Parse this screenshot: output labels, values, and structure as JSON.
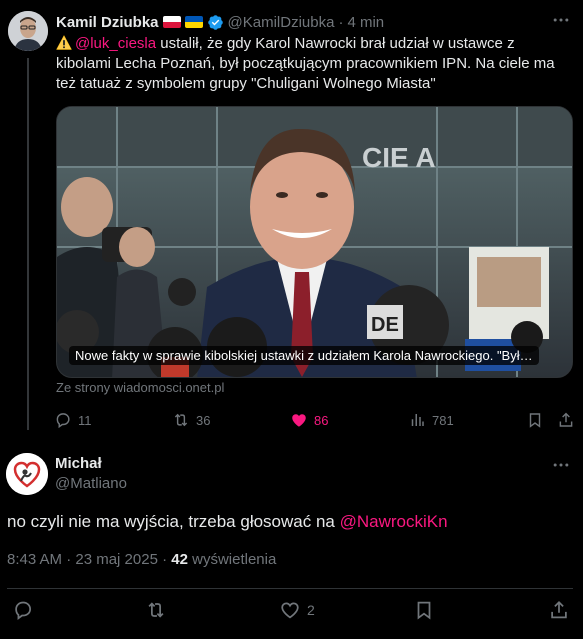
{
  "tweet": {
    "author_name": "Kamil Dziubka",
    "author_handle": "@KamilDziubka",
    "separator": "·",
    "time_ago": "4 min",
    "mention": "@luk_ciesla",
    "text_part1": " ustalił, że gdy Karol Nawrocki brał udział w ustawce z kibolami Lecha Poznań, był początkującym pracownikiem IPN. Na ciele ma też tatuaż z symbolem grupy \"Chuligani Wolnego Miasta\"",
    "card": {
      "caption": "Nowe fakty w sprawie kibolskiej ustawki z udziałem Karola Nawrockiego. \"Był ...",
      "source": "Ze strony wiadomosci.onet.pl"
    },
    "actions": {
      "replies": "11",
      "reposts": "36",
      "likes": "86",
      "views": "781"
    },
    "colors": {
      "like_active": "#f91880",
      "verified": "#1d9bf0",
      "muted": "#71767b"
    }
  },
  "reply": {
    "author_name": "Michał",
    "author_handle": "@Matliano",
    "text": "no czyli nie ma wyjścia, trzeba głosować na ",
    "mention": "@NawrockiKn",
    "time": "8:43 AM · 23 maj 2025 · ",
    "views_count": "42",
    "views_label": " wyświetlenia",
    "actions": {
      "likes": "2"
    }
  },
  "icons": [
    "more-icon",
    "verified-badge-icon",
    "warning-icon",
    "reply-icon",
    "repost-icon",
    "like-icon",
    "views-icon",
    "bookmark-icon",
    "share-icon"
  ]
}
